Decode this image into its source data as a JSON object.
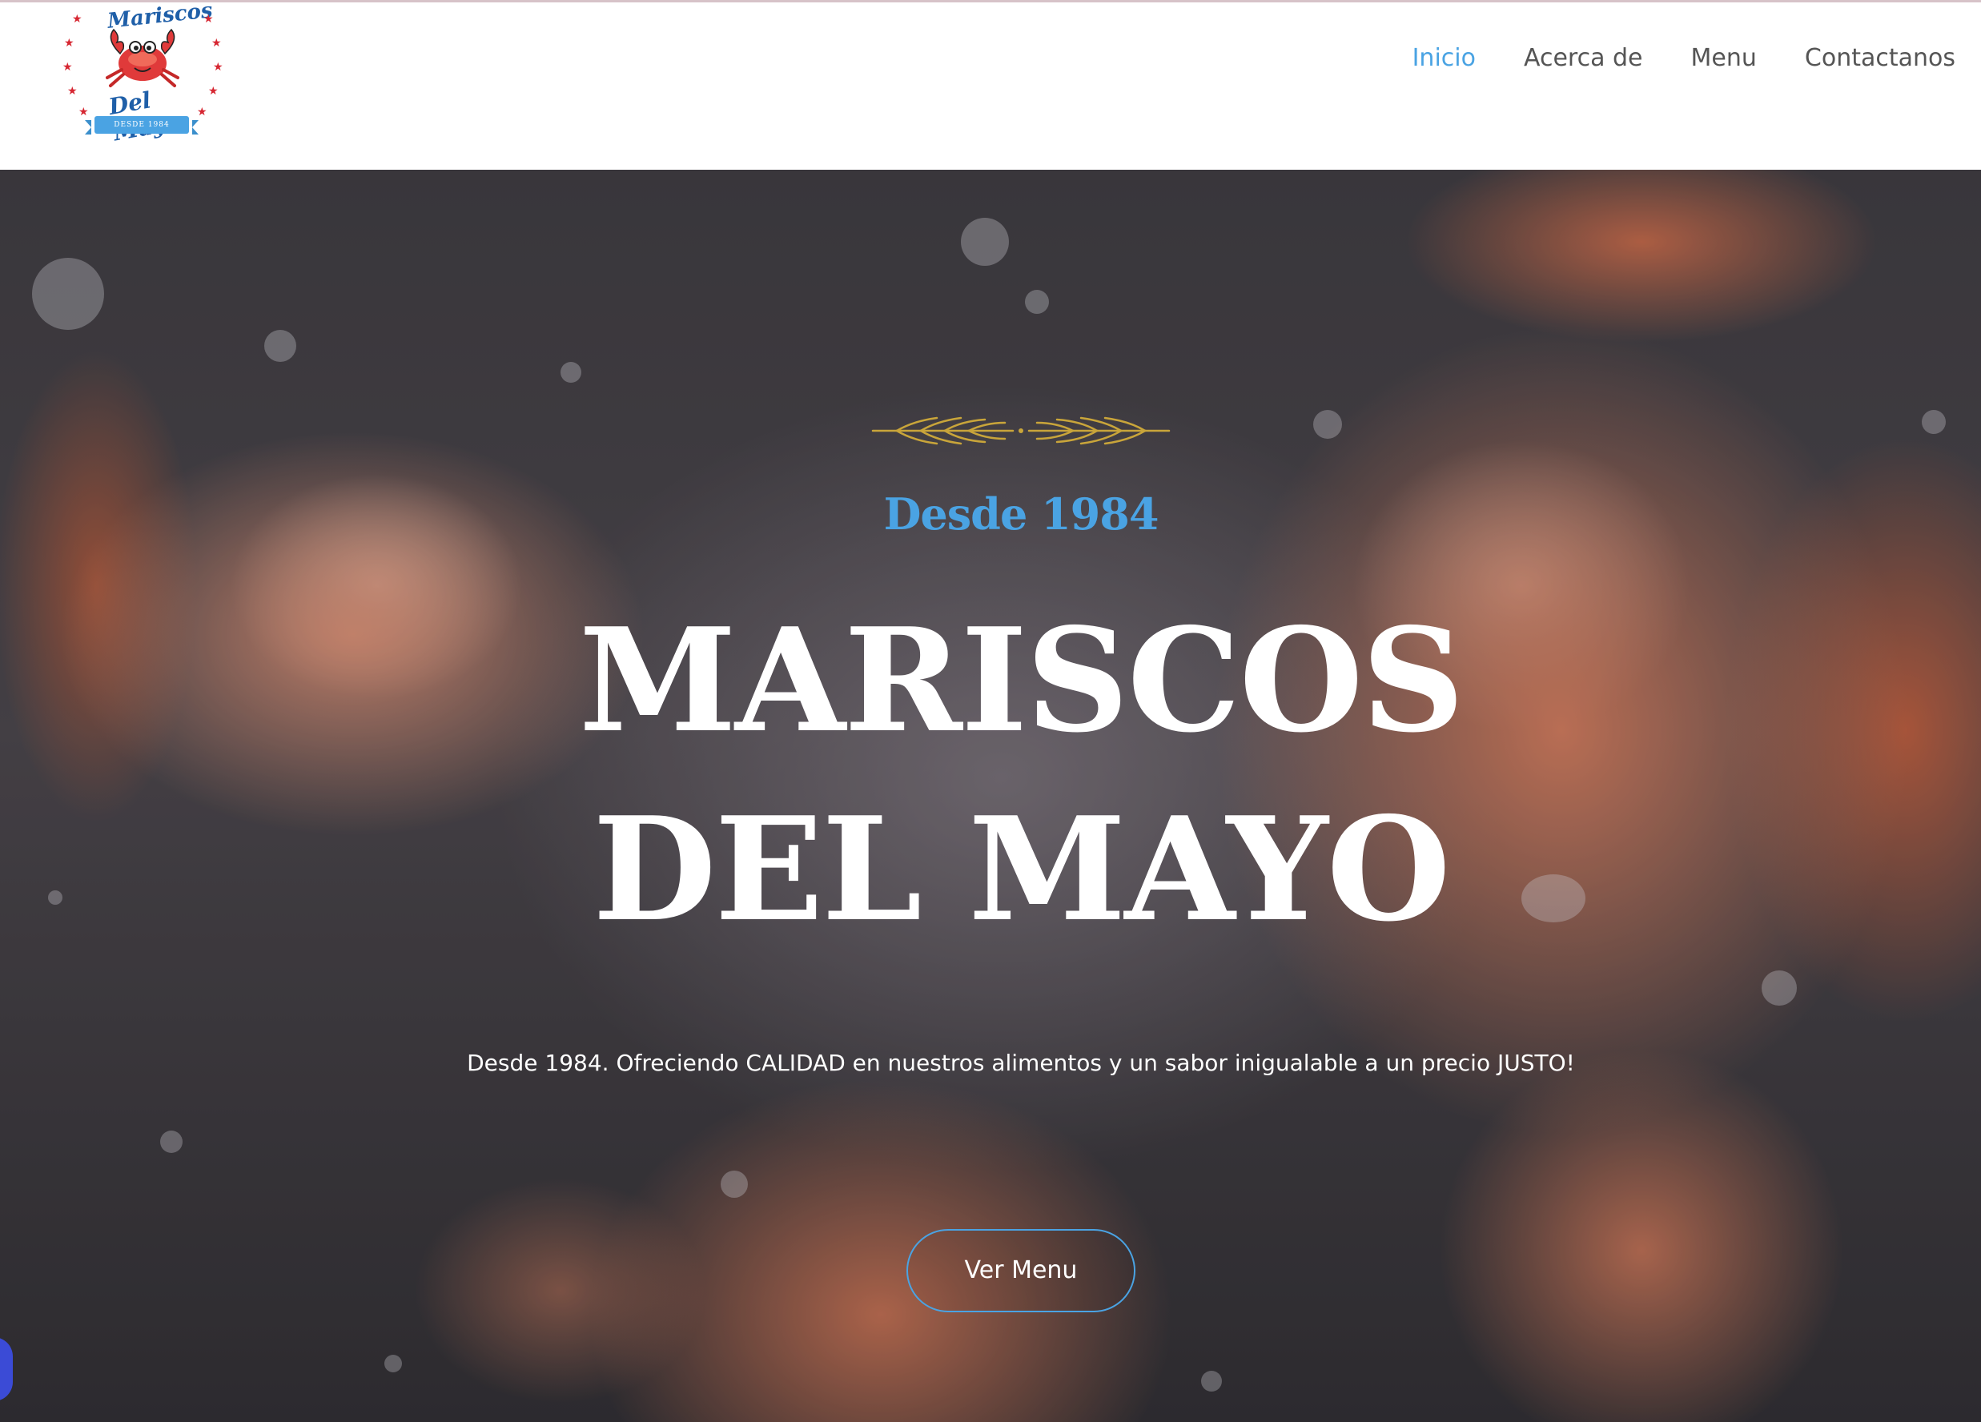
{
  "header": {
    "logo": {
      "name": "Mariscos Del Mayo",
      "script_top": "Mariscos",
      "script_bottom": "Del Mayo",
      "ribbon": "DESDE 1984",
      "icon": "crab-icon"
    },
    "nav": [
      {
        "label": "Inicio",
        "active": true
      },
      {
        "label": "Acerca de",
        "active": false
      },
      {
        "label": "Menu",
        "active": false
      },
      {
        "label": "Contactanos",
        "active": false
      }
    ]
  },
  "hero": {
    "ornament_icon": "wheat-divider-icon",
    "subtitle": "Desde 1984",
    "title_line1": "MARISCOS",
    "title_line2": "DEL MAYO",
    "description": "Desde 1984. Ofreciendo CALIDAD en nuestros alimentos y un sabor inigualable a un precio JUSTO!",
    "button_label": "Ver Menu",
    "background": "shrimp-photo"
  },
  "colors": {
    "accent": "#4aa3e3",
    "nav_text": "#555555",
    "hero_text": "#ffffff",
    "ornament": "#c9a53a",
    "logo_red": "#d62631"
  }
}
